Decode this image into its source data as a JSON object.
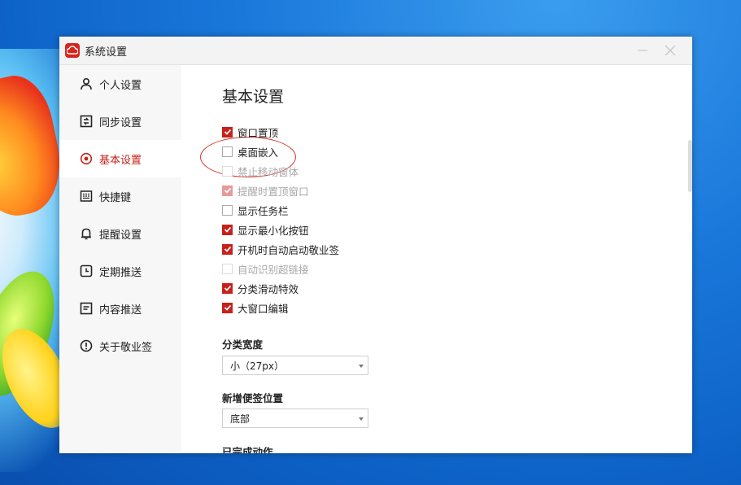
{
  "window": {
    "title": "系统设置"
  },
  "sidebar": {
    "items": [
      {
        "label": "个人设置",
        "icon": "user-icon",
        "active": false
      },
      {
        "label": "同步设置",
        "icon": "sync-icon",
        "active": false
      },
      {
        "label": "基本设置",
        "icon": "settings-icon",
        "active": true
      },
      {
        "label": "快捷键",
        "icon": "keyboard-icon",
        "active": false
      },
      {
        "label": "提醒设置",
        "icon": "bell-icon",
        "active": false
      },
      {
        "label": "定期推送",
        "icon": "clock-icon",
        "active": false
      },
      {
        "label": "内容推送",
        "icon": "document-icon",
        "active": false
      },
      {
        "label": "关于敬业签",
        "icon": "info-icon",
        "active": false
      }
    ]
  },
  "main": {
    "title": "基本设置",
    "options": [
      {
        "label": "窗口置顶",
        "checked": true,
        "disabled": false
      },
      {
        "label": "桌面嵌入",
        "checked": false,
        "disabled": false
      },
      {
        "label": "禁止移动窗体",
        "checked": false,
        "disabled": true
      },
      {
        "label": "提醒时置顶窗口",
        "checked": true,
        "disabled": true
      },
      {
        "label": "显示任务栏",
        "checked": false,
        "disabled": false
      },
      {
        "label": "显示最小化按钮",
        "checked": true,
        "disabled": false
      },
      {
        "label": "开机时自动启动敬业签",
        "checked": true,
        "disabled": false
      },
      {
        "label": "自动识别超链接",
        "checked": false,
        "disabled": true
      },
      {
        "label": "分类滑动特效",
        "checked": true,
        "disabled": false
      },
      {
        "label": "大窗口编辑",
        "checked": true,
        "disabled": false
      }
    ],
    "category_width": {
      "label": "分类宽度",
      "value": "小（27px）"
    },
    "new_note_position": {
      "label": "新增便签位置",
      "value": "底部"
    },
    "completed_action": {
      "label": "已完成动作"
    }
  },
  "colors": {
    "accent": "#c8201a",
    "sidebar_bg": "#f7f7f7",
    "titlebar_bg": "#f3f3f3"
  }
}
